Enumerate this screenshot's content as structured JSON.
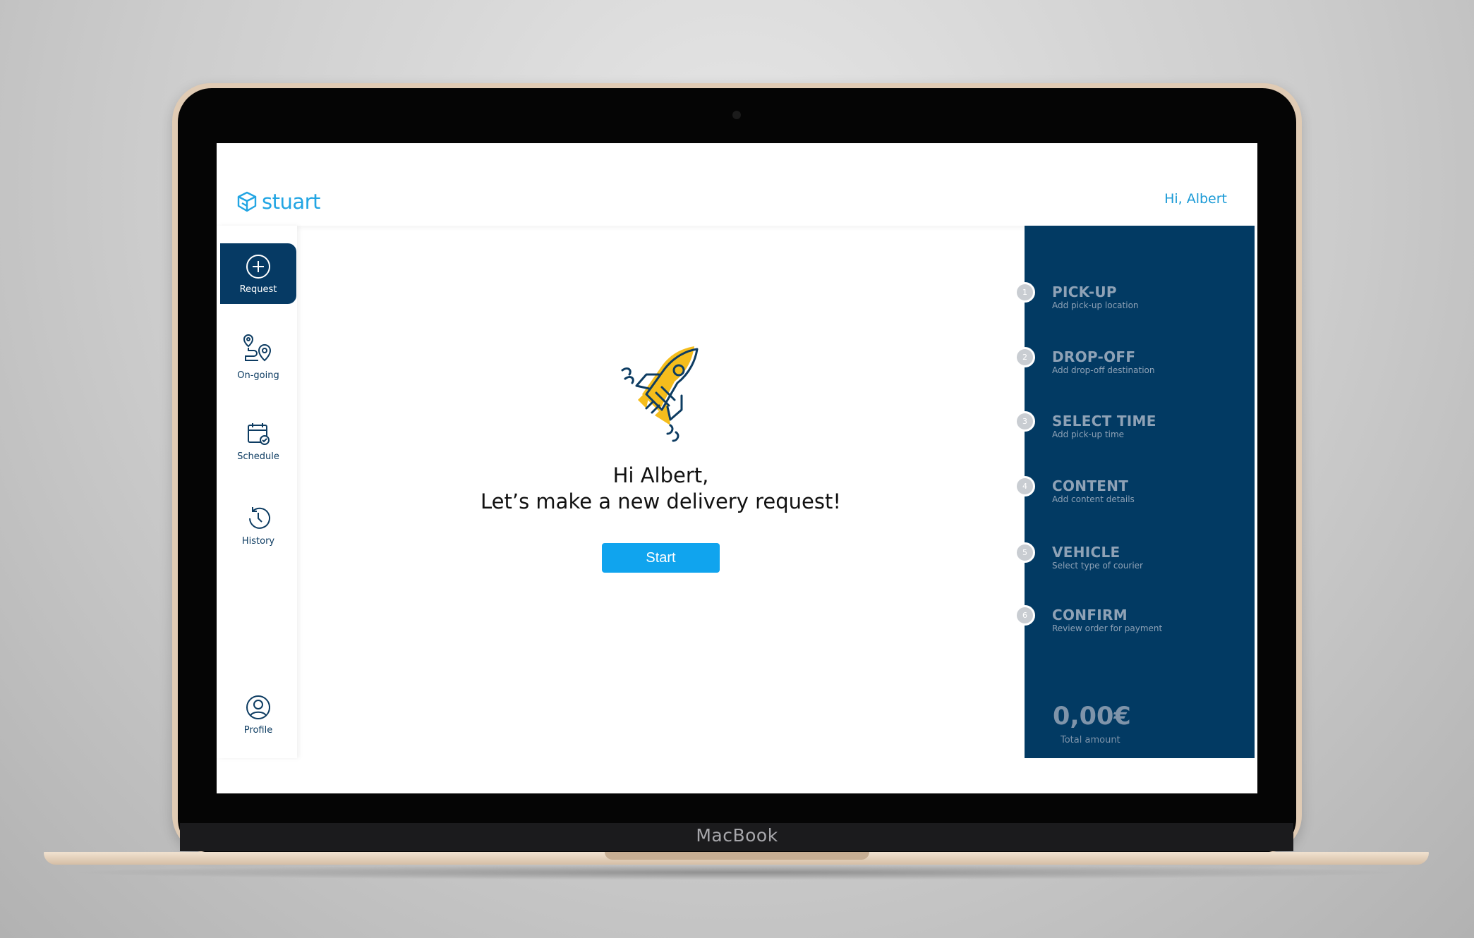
{
  "device": {
    "brand": "MacBook"
  },
  "header": {
    "logo_text": "stuart",
    "greeting": "Hi, Albert"
  },
  "sidebar": {
    "items": [
      {
        "label": "Request",
        "icon": "plus-circle-icon",
        "active": true
      },
      {
        "label": "On-going",
        "icon": "route-pin-icon",
        "active": false
      },
      {
        "label": "Schedule",
        "icon": "calendar-check-icon",
        "active": false
      },
      {
        "label": "History",
        "icon": "history-clock-icon",
        "active": false
      },
      {
        "label": "Profile",
        "icon": "user-icon",
        "active": false
      }
    ]
  },
  "main": {
    "greeting_line1": "Hi Albert,",
    "greeting_line2": "Let’s make a new delivery request!",
    "start_label": "Start",
    "illustration": "rocket-icon"
  },
  "steps": [
    {
      "number": "1",
      "title": "PICK-UP",
      "subtitle": "Add pick-up location"
    },
    {
      "number": "2",
      "title": "DROP-OFF",
      "subtitle": "Add drop-off destination"
    },
    {
      "number": "3",
      "title": "SELECT TIME",
      "subtitle": "Add pick-up time"
    },
    {
      "number": "4",
      "title": "CONTENT",
      "subtitle": "Add content details"
    },
    {
      "number": "5",
      "title": "VEHICLE",
      "subtitle": "Select type of courier"
    },
    {
      "number": "6",
      "title": "CONFIRM",
      "subtitle": "Review order for payment"
    }
  ],
  "total": {
    "amount": "0,00€",
    "label": "Total amount"
  },
  "colors": {
    "brand_blue": "#22a5e3",
    "navy": "#023a63",
    "start_button": "#10a4ee",
    "rocket_yellow": "#f5bd1c"
  }
}
